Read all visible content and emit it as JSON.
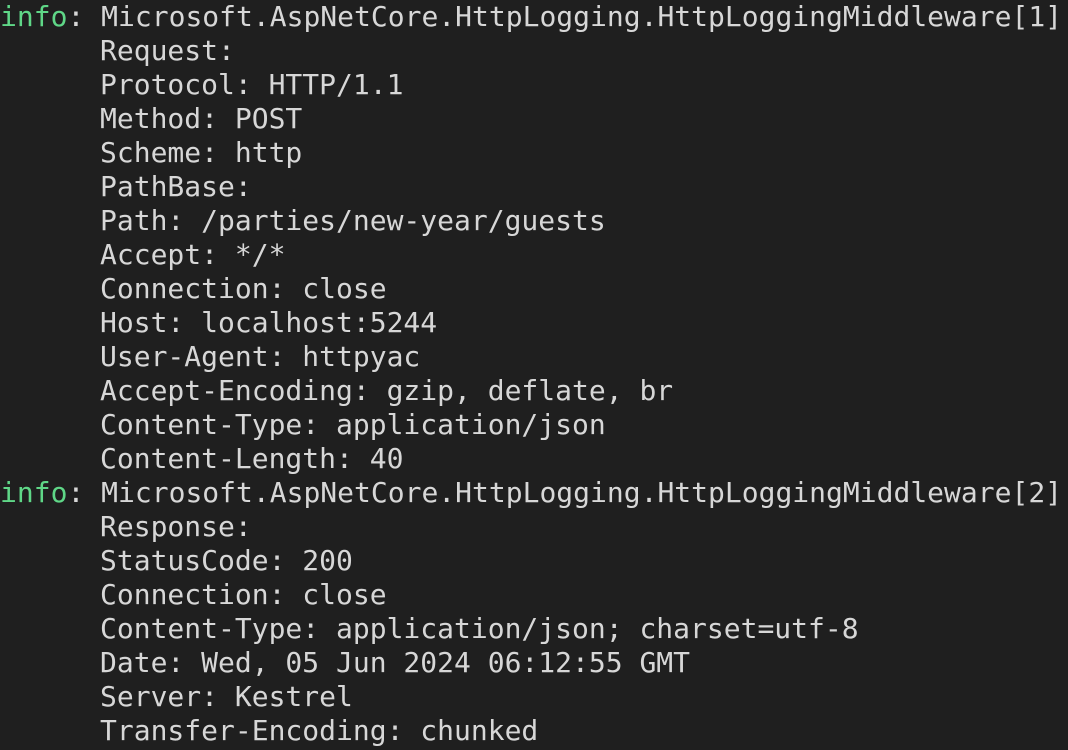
{
  "colors": {
    "background": "#1f1f1f",
    "text": "#d7d7d7",
    "info_level": "#5fd787"
  },
  "log_entries": [
    {
      "level": "info",
      "separator": ": ",
      "category": "Microsoft.AspNetCore.HttpLogging.HttpLoggingMiddleware[1]",
      "lines": [
        "Request:",
        "Protocol: HTTP/1.1",
        "Method: POST",
        "Scheme: http",
        "PathBase:",
        "Path: /parties/new-year/guests",
        "Accept: */*",
        "Connection: close",
        "Host: localhost:5244",
        "User-Agent: httpyac",
        "Accept-Encoding: gzip, deflate, br",
        "Content-Type: application/json",
        "Content-Length: 40"
      ]
    },
    {
      "level": "info",
      "separator": ": ",
      "category": "Microsoft.AspNetCore.HttpLogging.HttpLoggingMiddleware[2]",
      "lines": [
        "Response:",
        "StatusCode: 200",
        "Connection: close",
        "Content-Type: application/json; charset=utf-8",
        "Date: Wed, 05 Jun 2024 06:12:55 GMT",
        "Server: Kestrel",
        "Transfer-Encoding: chunked"
      ]
    }
  ]
}
